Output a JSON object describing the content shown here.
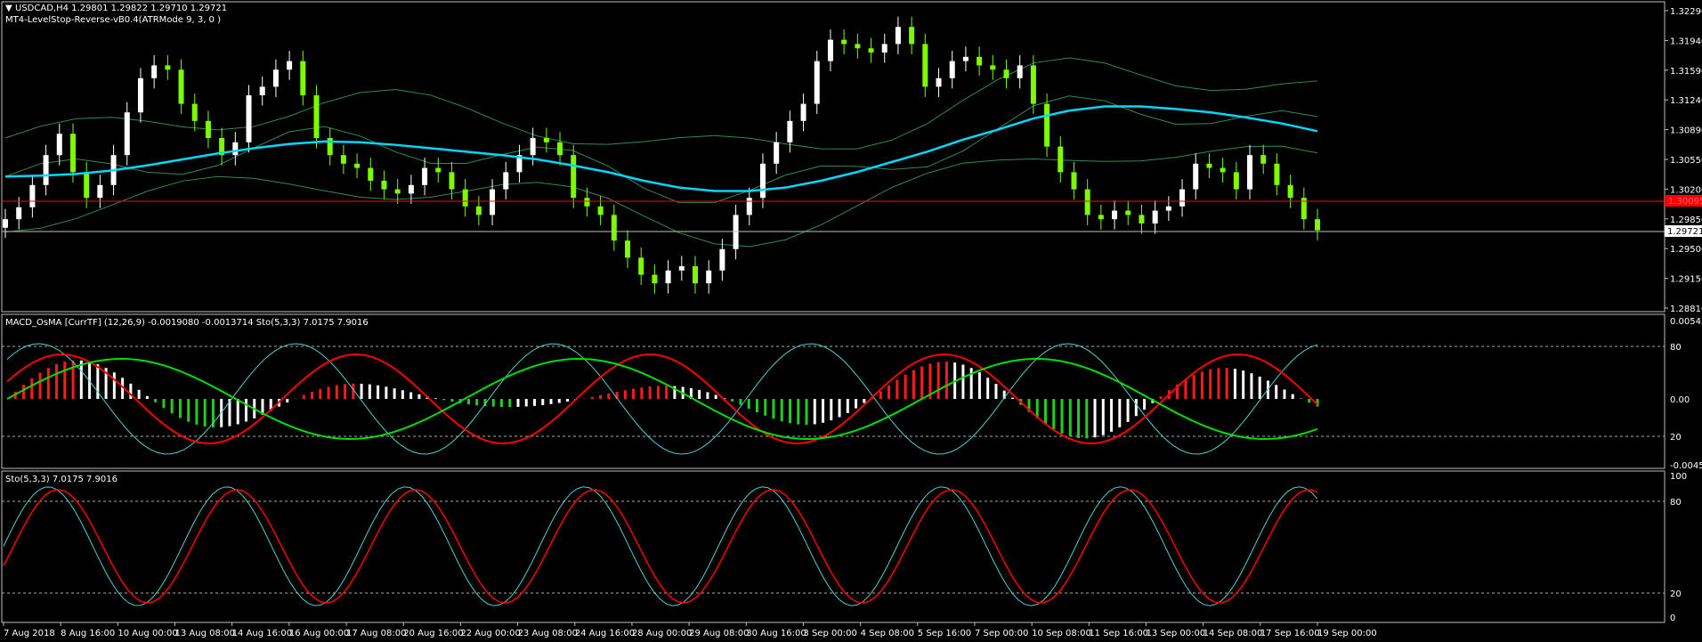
{
  "header": {
    "symbol_line": "USDCAD,H4  1.29801 1.29822 1.29710 1.29721",
    "indicator_line": "MT4-LevelStop-Reverse-vB0.4(ATRMode 9, 3, 0 )"
  },
  "price_axis": {
    "ticks": [
      "1.32290",
      "1.31940",
      "1.31590",
      "1.31240",
      "1.30890",
      "1.30550",
      "1.30200",
      "1.29850",
      "1.29500",
      "1.29150",
      "1.28810"
    ],
    "current_price": "1.29721",
    "red_level": "1.30095"
  },
  "macd_panel": {
    "title": "MACD_OsMA [CurrTF] (12,26,9) -0.0019080 -0.0013714  Sto(5,3,3) 7.0175 7.9016",
    "ticks": [
      "0.005456",
      "80",
      "0.00",
      "20",
      "-0.004529"
    ]
  },
  "sto_panel": {
    "title": "Sto(5,3,3) 7.0175 7.9016",
    "ticks": [
      "100",
      "80",
      "20",
      "0"
    ]
  },
  "time_axis": {
    "labels": [
      "7 Aug 2018",
      "8 Aug 16:00",
      "10 Aug 00:00",
      "13 Aug 08:00",
      "14 Aug 16:00",
      "16 Aug 00:00",
      "17 Aug 08:00",
      "20 Aug 16:00",
      "22 Aug 00:00",
      "23 Aug 08:00",
      "24 Aug 16:00",
      "28 Aug 00:00",
      "29 Aug 08:00",
      "30 Aug 16:00",
      "3 Sep 00:00",
      "4 Sep 08:00",
      "5 Sep 16:00",
      "7 Sep 00:00",
      "10 Sep 08:00",
      "11 Sep 16:00",
      "13 Sep 00:00",
      "14 Sep 08:00",
      "17 Sep 16:00",
      "19 Sep 00:00"
    ]
  },
  "colors": {
    "background": "#000000",
    "candle_up": "#ffffff",
    "candle_down": "#7cfc00",
    "ma_line": "#00d8ff",
    "bands": "#2e8b57",
    "red_level": "#ff0000",
    "osma_up": "#ff1a1a",
    "osma_down": "#22cc22",
    "signal_red": "#ff0000",
    "signal_green": "#00e000",
    "sto_main": "#4fd0d0",
    "sto_signal": "#ff0000"
  },
  "chart_data": {
    "type": "candlestick",
    "price_series_closes": [
      1.2985,
      1.2999,
      1.3025,
      1.306,
      1.3085,
      1.304,
      1.301,
      1.3025,
      1.306,
      1.311,
      1.315,
      1.3165,
      1.316,
      1.312,
      1.31,
      1.308,
      1.306,
      1.3075,
      1.313,
      1.314,
      1.316,
      1.317,
      1.313,
      1.308,
      1.306,
      1.305,
      1.3045,
      1.303,
      1.302,
      1.3015,
      1.3025,
      1.3045,
      1.304,
      1.302,
      1.3,
      1.299,
      1.302,
      1.304,
      1.306,
      1.308,
      1.3075,
      1.306,
      1.301,
      1.3,
      1.299,
      1.296,
      1.294,
      1.292,
      1.291,
      1.2925,
      1.293,
      1.291,
      1.2925,
      1.295,
      1.299,
      1.301,
      1.305,
      1.3075,
      1.31,
      1.312,
      1.317,
      1.3195,
      1.319,
      1.3185,
      1.318,
      1.319,
      1.321,
      1.319,
      1.314,
      1.315,
      1.317,
      1.3175,
      1.3165,
      1.316,
      1.315,
      1.3165,
      1.312,
      1.307,
      1.304,
      1.302,
      1.299,
      1.2985,
      1.2995,
      1.299,
      1.298,
      1.2995,
      1.3,
      1.302,
      1.305,
      1.3045,
      1.304,
      1.302,
      1.306,
      1.305,
      1.3025,
      1.301,
      1.2985,
      1.2972
    ],
    "ma_line": [
      1.3035,
      1.3036,
      1.3038,
      1.3042,
      1.3048,
      1.3055,
      1.3062,
      1.3068,
      1.3073,
      1.3076,
      1.3075,
      1.3072,
      1.3068,
      1.3064,
      1.306,
      1.3055,
      1.3048,
      1.304,
      1.303,
      1.3022,
      1.3018,
      1.3018,
      1.3022,
      1.303,
      1.304,
      1.3052,
      1.3064,
      1.3078,
      1.309,
      1.3103,
      1.3112,
      1.3117,
      1.3117,
      1.3114,
      1.311,
      1.3104,
      1.3097,
      1.3088
    ],
    "red_level": 1.30095,
    "current_price": 1.29721,
    "ylim": [
      1.2881,
      1.3239
    ]
  }
}
